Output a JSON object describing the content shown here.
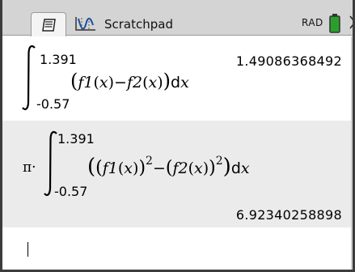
{
  "tabs": {
    "app_label": "Scratchpad"
  },
  "status": {
    "angle_mode": "RAD",
    "battery_color": "#2aa02a"
  },
  "history": [
    {
      "upper_bound": "1.391",
      "lower_bound": "-0.57",
      "integrand_a_name": "f1",
      "integrand_b_name": "f2",
      "variable": "x",
      "result": "1.49086368492"
    },
    {
      "prefix": "π·",
      "upper_bound": "1.391",
      "lower_bound": "-0.57",
      "integrand_a_name": "f1",
      "integrand_b_name": "f2",
      "exponent": "2",
      "variable": "x",
      "result": "6.92340258898"
    }
  ],
  "colors": {
    "entry_alt_background": "#ebebeb",
    "tabbar_background": "#d4d4d4"
  }
}
